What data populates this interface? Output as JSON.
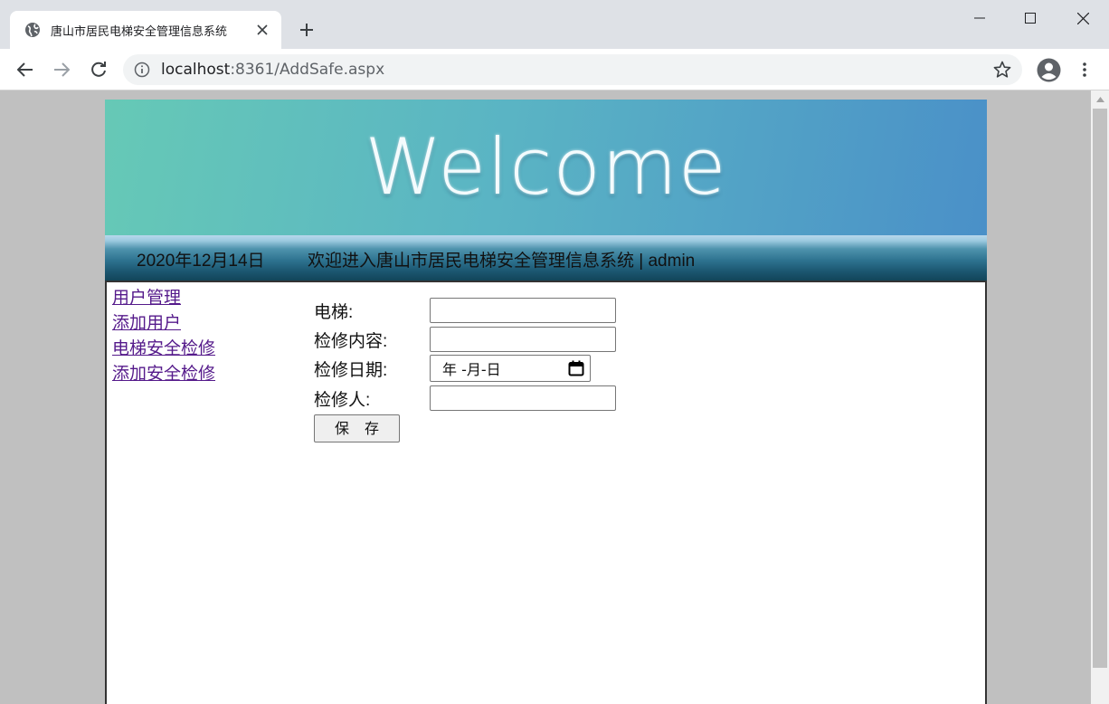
{
  "browser": {
    "tab_title": "唐山市居民电梯安全管理信息系统",
    "url_host": "localhost",
    "url_rest": ":8361/AddSafe.aspx"
  },
  "banner": {
    "text": "Welcome"
  },
  "infobar": {
    "date": "2020年12月14日",
    "welcome": "欢迎进入唐山市居民电梯安全管理信息系统 | admin"
  },
  "nav": {
    "items": [
      {
        "label": "用户管理"
      },
      {
        "label": "添加用户"
      },
      {
        "label": "电梯安全检修"
      },
      {
        "label": "添加安全检修"
      }
    ]
  },
  "form": {
    "elevator_label": "电梯:",
    "elevator_value": "",
    "content_label": "检修内容:",
    "content_value": "",
    "date_label": "检修日期:",
    "date_placeholder": "年 -月-日",
    "inspector_label": "检修人:",
    "inspector_value": "",
    "save_label": "保 存"
  },
  "colors": {
    "link_visited": "#551a8b",
    "banner_start": "#66c9b6",
    "banner_end": "#4a90c8",
    "infobar_dark": "#124559"
  },
  "icons": {
    "tab": "globe-icon",
    "tab_close": "close-icon",
    "new_tab": "plus-icon",
    "back": "arrow-left-icon",
    "forward": "arrow-right-icon",
    "reload": "reload-icon",
    "site_info": "info-icon",
    "bookmark": "star-icon",
    "profile": "account-icon",
    "menu": "kebab-menu-icon",
    "date_picker": "calendar-icon"
  }
}
